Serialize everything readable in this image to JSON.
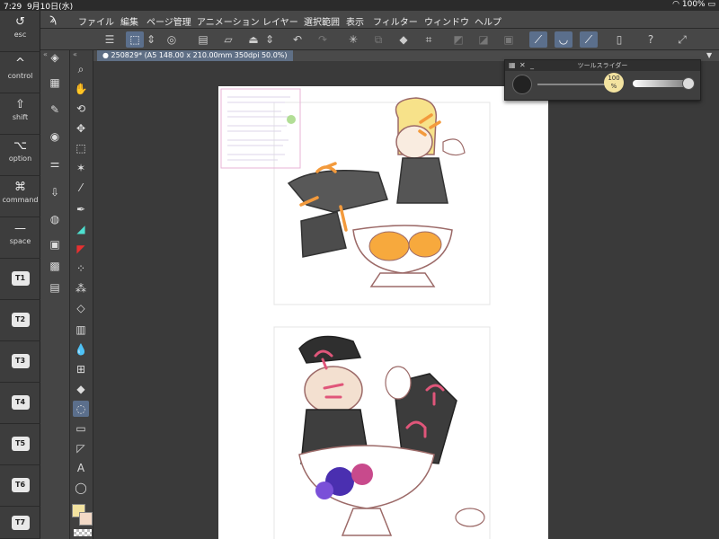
{
  "status_bar": {
    "time": "7:29",
    "date": "9月10日(水)",
    "battery": "100%"
  },
  "edge_keys": [
    {
      "glyph": "↺",
      "label": "esc"
    },
    {
      "glyph": "^",
      "label": "control"
    },
    {
      "glyph": "⇧",
      "label": "shift"
    },
    {
      "glyph": "⌥",
      "label": "option"
    },
    {
      "glyph": "⌘",
      "label": "command"
    },
    {
      "glyph": "—",
      "label": "space"
    },
    {
      "box": "T1"
    },
    {
      "box": "T2"
    },
    {
      "box": "T3"
    },
    {
      "box": "T4"
    },
    {
      "box": "T5"
    },
    {
      "box": "T6"
    },
    {
      "box": "T7"
    }
  ],
  "menu": {
    "items": [
      "ファイル",
      "編集",
      "ページ管理",
      "アニメーション",
      "レイヤー",
      "選択範囲",
      "表示",
      "フィルター",
      "ウィンドウ",
      "ヘルプ"
    ]
  },
  "document": {
    "tab_label": "250829* (A5 148.00 x 210.00mm 350dpi 50.0%)"
  },
  "tool_slider": {
    "title": "ツールスライダー",
    "opacity_label": "100",
    "opacity_unit": "%"
  },
  "colors": {
    "main": "#f3e3a0",
    "sub": "#f2d9c6",
    "accent_selected": "#5b6f8c",
    "orange": "#f39a3c",
    "pink": "#e0567a"
  }
}
